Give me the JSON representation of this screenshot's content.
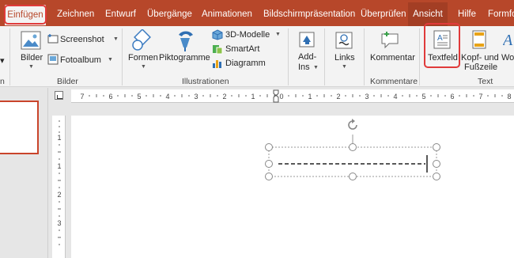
{
  "tabs": [
    {
      "label": "Einfügen"
    },
    {
      "label": "Zeichnen"
    },
    {
      "label": "Entwurf"
    },
    {
      "label": "Übergänge"
    },
    {
      "label": "Animationen"
    },
    {
      "label": "Bildschirmpräsentation"
    },
    {
      "label": "Überprüfen"
    },
    {
      "label": "Ansicht"
    },
    {
      "label": "Hilfe"
    },
    {
      "label": "Formfo"
    }
  ],
  "ribbon": {
    "bilder": {
      "label": "Bilder",
      "screenshot": "Screenshot",
      "fotoalbum": "Fotoalbum",
      "group": "Bilder"
    },
    "illustrationen": {
      "formen": "Formen",
      "piktogramme": "Piktogramme",
      "modelle": "3D-Modelle",
      "smartart": "SmartArt",
      "diagramm": "Diagramm",
      "group": "Illustrationen"
    },
    "addins": {
      "line1": "Add-",
      "line2": "Ins"
    },
    "links": {
      "label": "Links"
    },
    "kommentare": {
      "label": "Kommentar",
      "group": "Kommentare"
    },
    "text": {
      "textfeld": "Textfeld",
      "kopf1": "Kopf- und",
      "kopf2": "Fußzeile",
      "wo": "Wo",
      "group": "Text"
    },
    "left_edge_label": "n"
  },
  "ruler": {
    "h_numbers": [
      "7",
      "6",
      "5",
      "4",
      "3",
      "2",
      "1",
      "0",
      "1",
      "2",
      "3",
      "4",
      "5",
      "6",
      "7",
      "8"
    ],
    "v_numbers": [
      "1",
      "1",
      "2",
      "3"
    ]
  },
  "colors": {
    "accent": "#b7472a",
    "highlight": "#e03a3a"
  }
}
